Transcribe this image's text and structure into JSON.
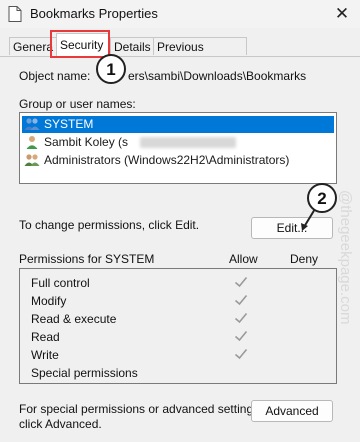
{
  "window": {
    "title": "Bookmarks Properties",
    "close_glyph": "✕"
  },
  "tabs": [
    {
      "label": "General",
      "active": false
    },
    {
      "label": "Security",
      "active": true
    },
    {
      "label": "Details",
      "active": false
    },
    {
      "label": "Previous Versions",
      "active": false
    }
  ],
  "tabs_visible": {
    "general_partial": "Genera"
  },
  "object": {
    "label": "Object name:",
    "value": "ers\\sambi\\Downloads\\Bookmarks"
  },
  "group": {
    "label": "Group or user names:",
    "items": [
      {
        "name": "SYSTEM",
        "selected": true,
        "icon": "users-group-icon"
      },
      {
        "name": "Sambit Koley (s",
        "selected": false,
        "icon": "user-icon"
      },
      {
        "name": "Administrators (Windows22H2\\Administrators)",
        "selected": false,
        "icon": "admin-group-icon"
      }
    ]
  },
  "change_permissions": {
    "text": "To change permissions, click Edit.",
    "edit_button": "Edit..."
  },
  "permissions": {
    "header": "Permissions for SYSTEM",
    "allow_label": "Allow",
    "deny_label": "Deny",
    "rows": [
      {
        "name": "Full control",
        "allow": true
      },
      {
        "name": "Modify",
        "allow": true
      },
      {
        "name": "Read & execute",
        "allow": true
      },
      {
        "name": "Read",
        "allow": true
      },
      {
        "name": "Write",
        "allow": true
      },
      {
        "name": "Special permissions",
        "allow": false
      }
    ]
  },
  "advanced": {
    "text_line1": "For special permissions or advanced settings,",
    "text_line2": "click Advanced.",
    "button": "Advanced"
  },
  "annotations": {
    "badge1": "1",
    "badge2": "2",
    "highlight_color": "#e83a3a"
  },
  "watermark": "@thegeekpage.com",
  "colors": {
    "selection": "#0078d7",
    "check": "#9a9a9a"
  }
}
